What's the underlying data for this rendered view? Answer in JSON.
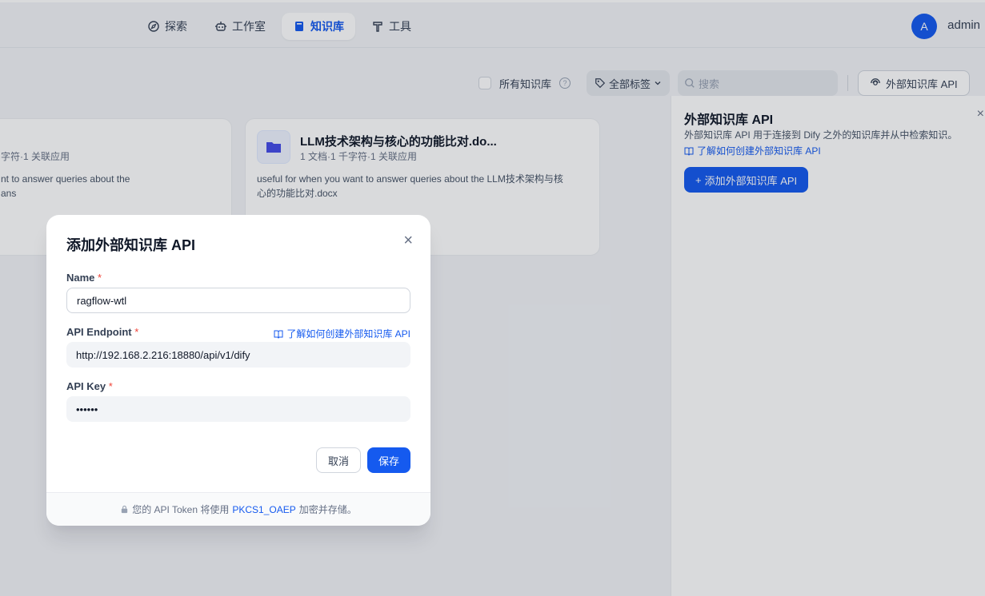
{
  "nav": {
    "items": [
      {
        "label": "探索",
        "icon": "compass-icon"
      },
      {
        "label": "工作室",
        "icon": "robot-icon"
      },
      {
        "label": "知识库",
        "icon": "book-icon",
        "active": true
      },
      {
        "label": "工具",
        "icon": "hammer-icon"
      }
    ],
    "user": {
      "initial": "A",
      "name": "admin"
    }
  },
  "toolbar": {
    "all_datasets_label": "所有知识库",
    "help": "?",
    "tags_label": "全部标签",
    "search_placeholder": "搜索",
    "external_api_label": "外部知识库 API"
  },
  "cards": [
    {
      "meta": "字符·1 关联应用",
      "desc_line1": "nt to answer queries about the",
      "desc_line2": "ans"
    },
    {
      "title": "LLM技术架构与核心的功能比对.do...",
      "meta": "1 文档·1 千字符·1 关联应用",
      "desc_line1": "useful for when you want to answer queries about the LLM技术架构与核",
      "desc_line2": "心的功能比对.docx"
    }
  ],
  "panel": {
    "title": "外部知识库 API",
    "close": "×",
    "description": "外部知识库 API 用于连接到 Dify 之外的知识库并从中检索知识。",
    "link": "了解如何创建外部知识库 API",
    "add_button": "添加外部知识库 API"
  },
  "modal": {
    "title": "添加外部知识库 API",
    "close": "×",
    "name_label": "Name",
    "name_value": "ragflow-wtl",
    "endpoint_label": "API Endpoint",
    "endpoint_link": "了解如何创建外部知识库 API",
    "endpoint_value": "http://192.168.2.216:18880/api/v1/dify",
    "key_label": "API Key",
    "key_value": "••••••",
    "required_mark": "*",
    "cancel_label": "取消",
    "save_label": "保存",
    "footer_prefix": "您的 API Token 将使用",
    "footer_algo": "PKCS1_OAEP",
    "footer_suffix": "加密并存储。"
  },
  "colors": {
    "accent": "#155aef",
    "required": "#f04438"
  }
}
